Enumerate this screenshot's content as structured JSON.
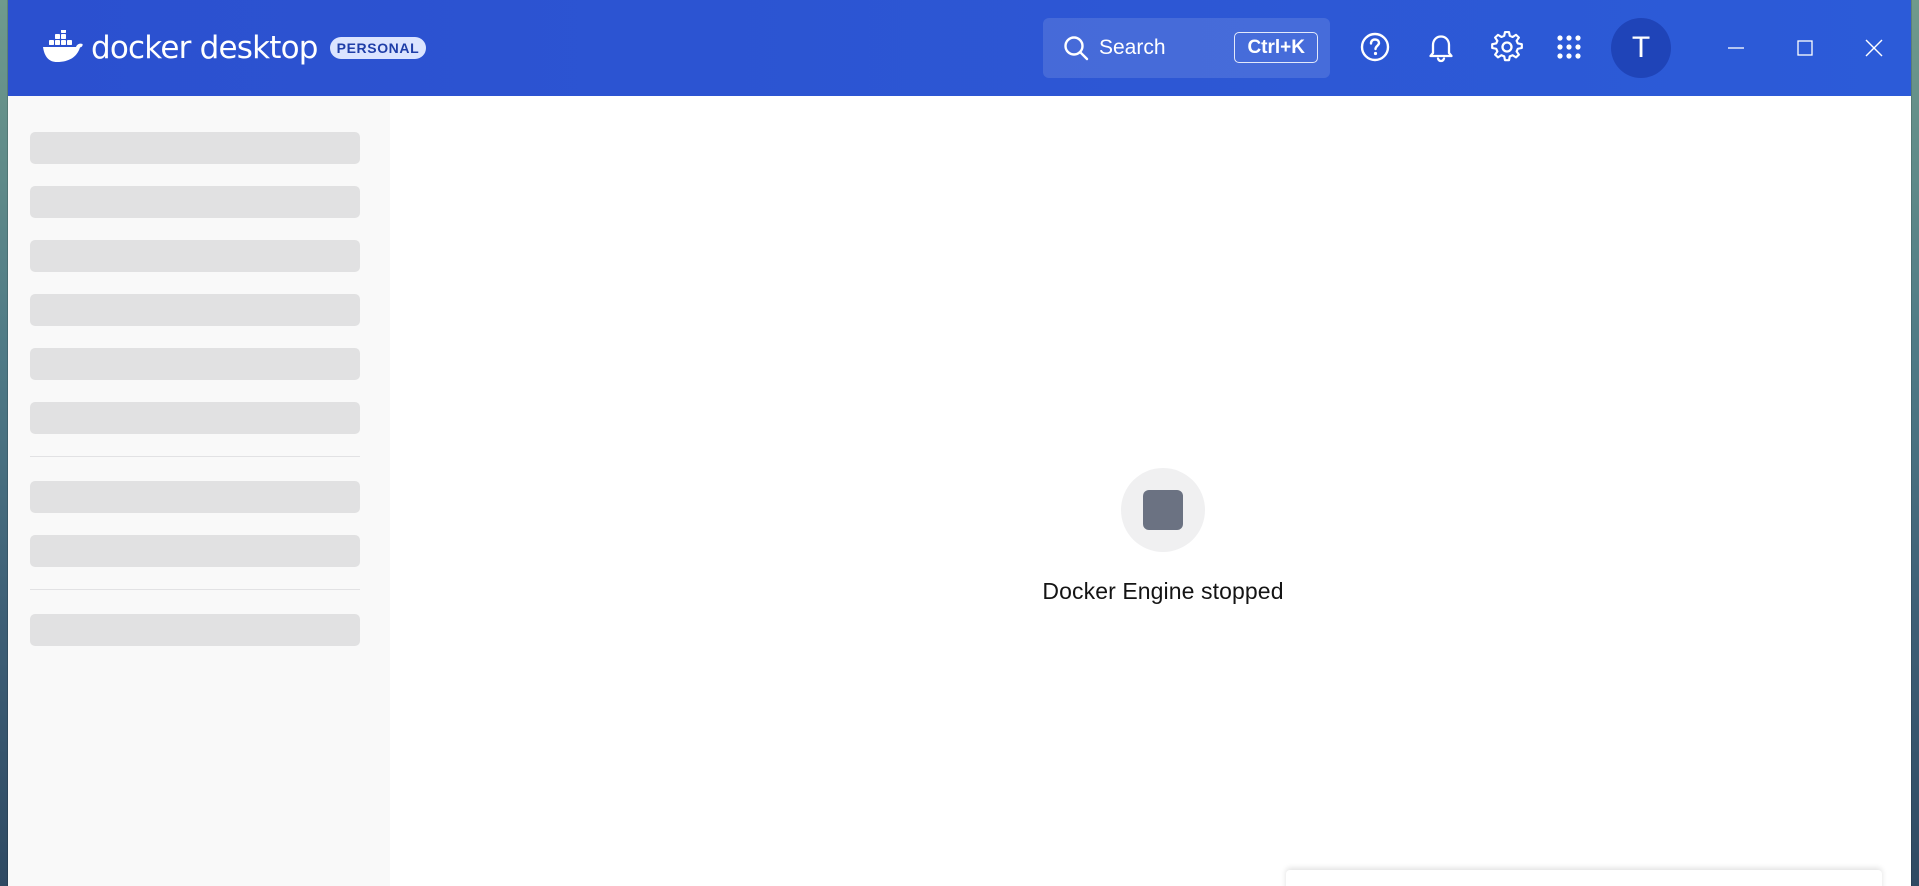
{
  "app": {
    "brand_name": "docker desktop",
    "plan_badge": "PERSONAL"
  },
  "header": {
    "search_label": "Search",
    "search_shortcut": "Ctrl+K",
    "avatar_initial": "T",
    "icons": [
      "help-icon",
      "notifications-icon",
      "settings-icon",
      "extensions-grid-icon"
    ]
  },
  "sidebar": {
    "state": "loading",
    "skeleton_rows": 9,
    "groups": [
      6,
      2,
      1
    ]
  },
  "main": {
    "status_icon": "stop-icon",
    "status_text": "Docker Engine stopped"
  },
  "colors": {
    "header_bg": "#2c55d3",
    "avatar_bg": "#1f44b8",
    "badge_bg": "#dbe4ff",
    "stop_icon": "#6b7282",
    "skeleton": "#e1e1e2"
  }
}
